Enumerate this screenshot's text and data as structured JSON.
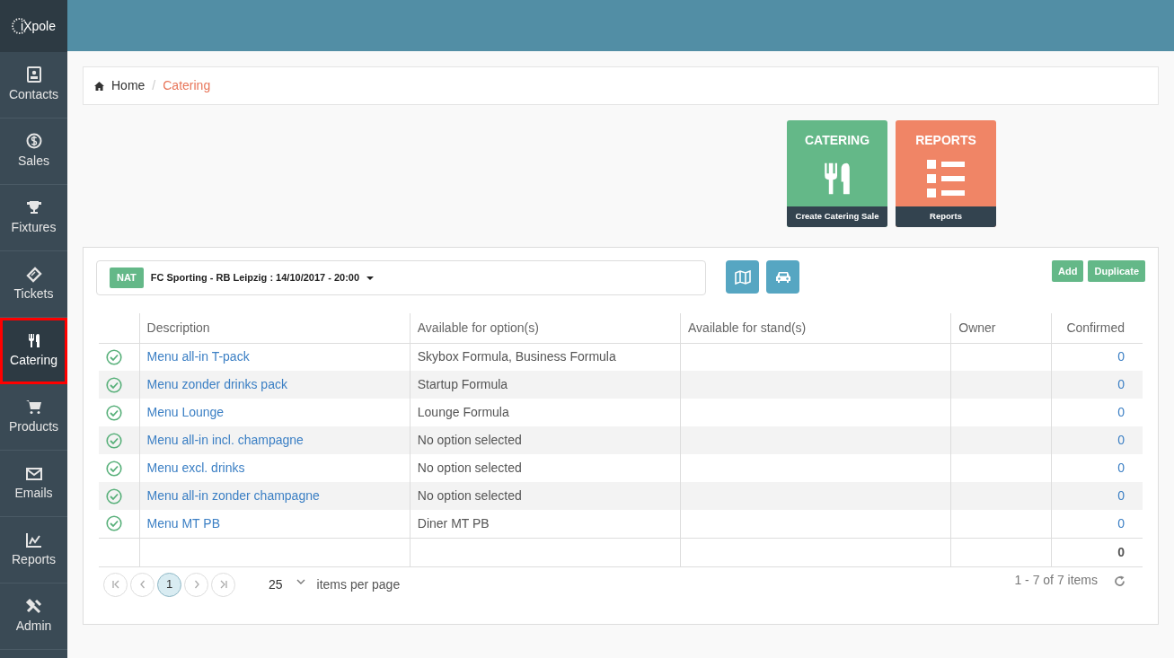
{
  "logo": {
    "text": "iXpole"
  },
  "sidebar": {
    "items": [
      {
        "label": "Contacts",
        "kind": "contacts",
        "selected": false
      },
      {
        "label": "Sales",
        "kind": "dollar",
        "selected": false
      },
      {
        "label": "Fixtures",
        "kind": "trophy",
        "selected": false
      },
      {
        "label": "Tickets",
        "kind": "ticket",
        "selected": false
      },
      {
        "label": "Catering",
        "kind": "cutlery",
        "selected": true
      },
      {
        "label": "Products",
        "kind": "cart",
        "selected": false
      },
      {
        "label": "Emails",
        "kind": "envelope",
        "selected": false
      },
      {
        "label": "Reports",
        "kind": "chart",
        "selected": false
      },
      {
        "label": "Admin",
        "kind": "tools",
        "selected": false
      }
    ]
  },
  "breadcrumb": [
    {
      "label": "Home",
      "current": false
    },
    {
      "separator": "/"
    },
    {
      "label": "Catering",
      "current": true
    }
  ],
  "tiles": [
    {
      "title": "CATERING",
      "caption": "Create Catering Sale",
      "kind": "cutlery",
      "color": "#64b888"
    },
    {
      "title": "REPORTS",
      "caption": "Reports",
      "kind": "list",
      "color": "#f08566"
    }
  ],
  "event_selector": {
    "badge": "NAT",
    "value": "FC Sporting - RB Leipzig : 14/10/2017 - 20:00"
  },
  "actions": [
    "Add",
    "Duplicate"
  ],
  "table": {
    "columns": [
      "Description",
      "Available for option(s)",
      "Available for stand(s)",
      "Owner",
      "Confirmed"
    ],
    "rows": [
      {
        "description": "Menu all-in T-pack",
        "options": "Skybox Formula, Business Formula",
        "confirmed": "0"
      },
      {
        "description": "Menu zonder drinks pack",
        "options": "Startup Formula",
        "confirmed": "0"
      },
      {
        "description": "Menu Lounge",
        "options": "Lounge Formula",
        "confirmed": "0"
      },
      {
        "description": "Menu all-in incl. champagne",
        "options": "No option selected",
        "confirmed": "0"
      },
      {
        "description": "Menu excl. drinks",
        "options": "No option selected",
        "confirmed": "0"
      },
      {
        "description": "Menu all-in zonder champagne",
        "options": "No option selected",
        "confirmed": "0"
      },
      {
        "description": "Menu MT PB",
        "options": "Diner MT PB",
        "confirmed": "0"
      }
    ],
    "total_confirmed": "0"
  },
  "pager": {
    "pages": [
      {
        "label": "1",
        "selected": true
      }
    ],
    "page_size": "25",
    "page_size_label": "items per page",
    "summary": "1 - 7 of 7 items"
  }
}
